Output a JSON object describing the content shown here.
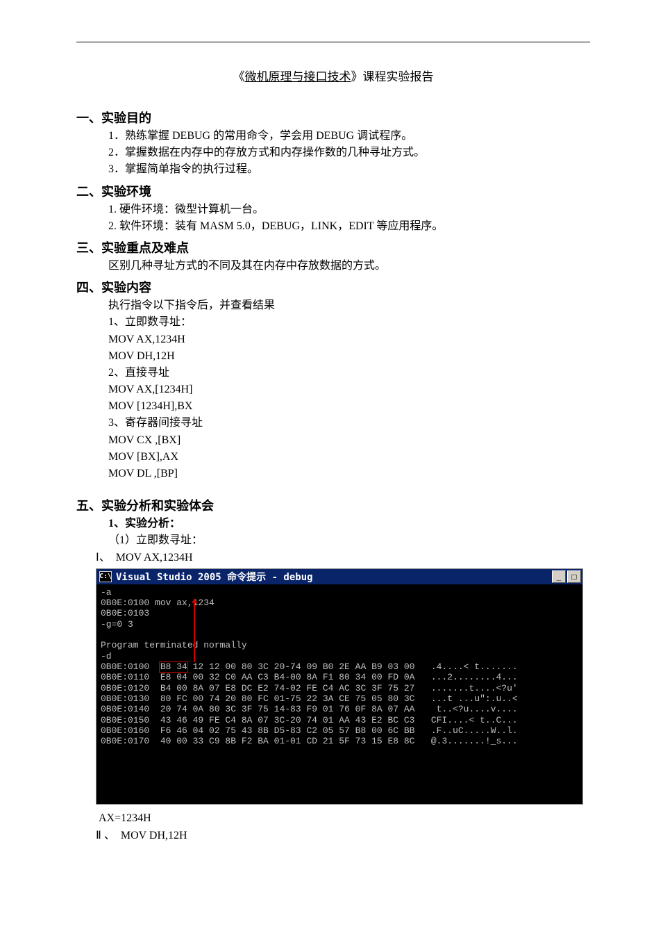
{
  "title_prefix": "《",
  "title_underlined": "微机原理与接口技术",
  "title_suffix": "》课程实验报告",
  "s1": {
    "heading": "一、实验目的",
    "items": [
      "1．熟练掌握 DEBUG 的常用命令，学会用 DEBUG 调试程序。",
      "2．掌握数据在内存中的存放方式和内存操作数的几种寻址方式。",
      "3．掌握简单指令的执行过程。"
    ]
  },
  "s2": {
    "heading": "二、实验环境",
    "items": [
      "1.  硬件环境：微型计算机一台。",
      "2.  软件环境：装有 MASM 5.0，DEBUG，LINK，EDIT 等应用程序。"
    ]
  },
  "s3": {
    "heading": "三、实验重点及难点",
    "line": "区别几种寻址方式的不同及其在内存中存放数据的方式。"
  },
  "s4": {
    "heading": "四、实验内容",
    "intro": "执行指令以下指令后，并查看结果",
    "g1_label": "1、立即数寻址：",
    "g1_code": [
      "MOV  AX,1234H",
      "MOV  DH,12H"
    ],
    "g2_label": "2、直接寻址",
    "g2_code": [
      "MOV  AX,[1234H]",
      "MOV  [1234H],BX"
    ],
    "g3_label": "3、寄存器间接寻址",
    "g3_code": [
      "MOV  CX  ,[BX]",
      "MOV  [BX],AX",
      "MOV  DL  ,[BP]"
    ]
  },
  "s5": {
    "heading": "五、实验分析和实验体会",
    "sub1": "1、实验分析：",
    "sub1_1": "（1）立即数寻址：",
    "line_i": "Ⅰ、　MOV  AX,1234H",
    "term_title": "Visual Studio 2005 命令提示 - debug",
    "term_icon": "C:\\",
    "btn_min": "_",
    "btn_max": "□",
    "term_lines": [
      "-a",
      "0B0E:0100 mov ax,1234",
      "0B0E:0103",
      "-g=0 3",
      "",
      "Program terminated normally",
      "-d",
      "0B0E:0100  B8 34 12 12 00 80 3C 20-74 09 B0 2E AA B9 03 00   .4....< t.......",
      "0B0E:0110  E8 04 00 32 C0 AA C3 B4-00 8A F1 80 34 00 FD 0A   ...2........4...",
      "0B0E:0120  B4 00 8A 07 E8 DC E2 74-02 FE C4 AC 3C 3F 75 27   .......t....<?u'",
      "0B0E:0130  80 FC 00 74 20 80 FC 01-75 22 3A CE 75 05 80 3C   ...t ...u\":.u..<",
      "0B0E:0140  20 74 0A 80 3C 3F 75 14-83 F9 01 76 0F 8A 07 AA    t..<?u....v....",
      "0B0E:0150  43 46 49 FE C4 8A 07 3C-20 74 01 AA 43 E2 BC C3   CFI....< t..C...",
      "0B0E:0160  F6 46 04 02 75 43 8B D5-83 C2 05 57 B8 00 6C BB   .F..uC.....W..l.",
      "0B0E:0170  40 00 33 C9 8B F2 BA 01-01 CD 21 5F 73 15 E8 8C   @.3.......!_s..."
    ],
    "after1": "AX=1234H",
    "line_ii": "Ⅱ 、　MOV  DH,12H"
  }
}
